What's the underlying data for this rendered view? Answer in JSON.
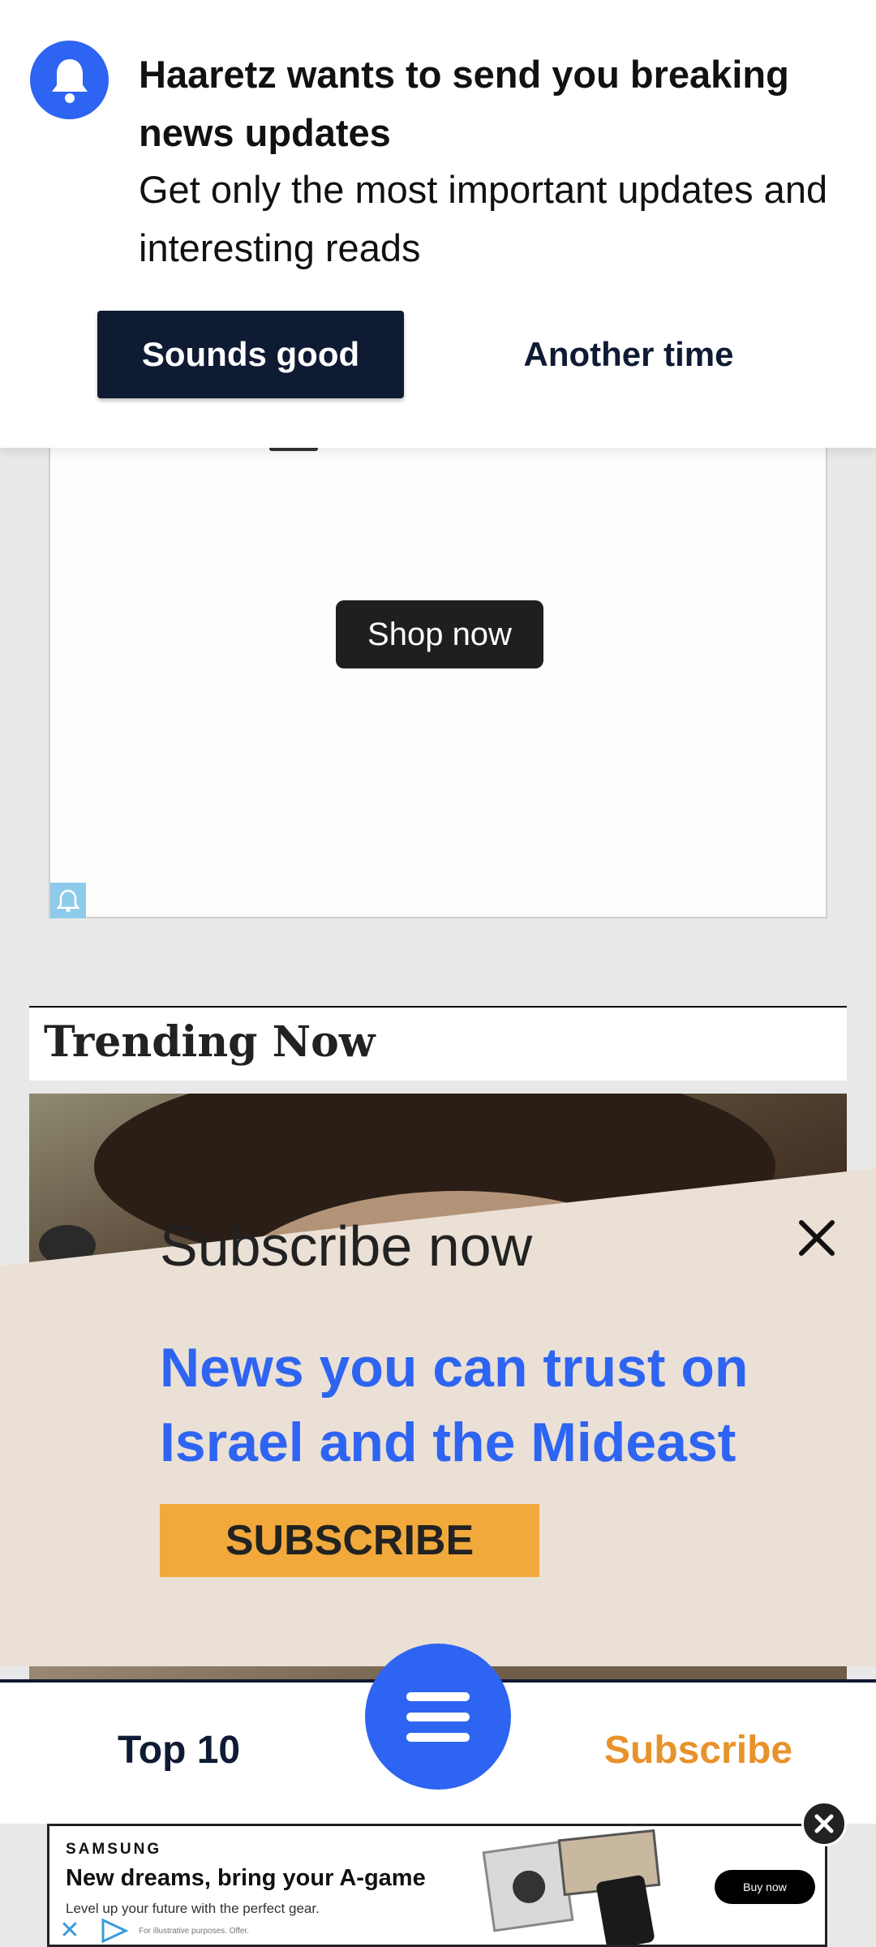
{
  "push_prompt": {
    "title": "Haaretz wants to send you breaking news updates",
    "body": "Get only the most important updates and interesting reads",
    "accept_label": "Sounds good",
    "decline_label": "Another time",
    "icon": "bell-icon"
  },
  "ad": {
    "cta_label": "Shop now",
    "adchoices_icon": "adchoices-icon"
  },
  "trending": {
    "title": "Trending Now"
  },
  "subscribe_overlay": {
    "heading": "Subscribe now",
    "tagline": "News you can trust on Israel and the Mideast",
    "button_label": "SUBSCRIBE",
    "close_icon": "close-icon"
  },
  "bottom_nav": {
    "left_label": "Top 10",
    "right_label": "Subscribe",
    "menu_icon": "hamburger-menu-icon"
  },
  "banner_ad": {
    "brand": "SAMSUNG",
    "headline": "New dreams, bring your A-game",
    "subline": "Level up your future with the perfect gear.",
    "fine_print": "For illustrative purposes. Offer.",
    "cta_label": "Buy now"
  },
  "colors": {
    "brand_blue": "#2e64f2",
    "navy": "#0f1a33",
    "subscribe_orange": "#e8922b",
    "subscribe_button": "#f2a93b",
    "overlay_bg": "#ebe0d6"
  }
}
